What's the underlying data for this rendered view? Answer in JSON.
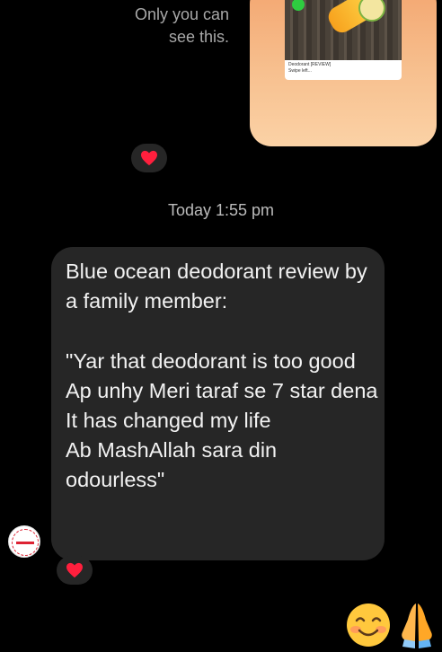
{
  "notice": {
    "line1": "Only you can",
    "line2": "see this."
  },
  "shared_post": {
    "caption_title": "Deodorant [REVIEW]",
    "caption_sub": "Swipe left..."
  },
  "timestamp": "Today 1:55 pm",
  "message": {
    "text": "Blue ocean deodorant review by a family member:\n\n\"Yar that deodorant is too good\nAp unhy Meri taraf se 7 star dena\nIt has changed my life\nAb MashAllah sara din odourless\""
  },
  "reactions": {
    "first": "heart",
    "second": "heart"
  },
  "colors": {
    "background": "#000000",
    "bubble": "#262626",
    "heart": "#ff1f3d",
    "card_top": "#f3a56f",
    "card_bottom": "#fbd2a6"
  },
  "quick_emojis": [
    "smiling-face-emoji",
    "folded-hands-emoji"
  ]
}
